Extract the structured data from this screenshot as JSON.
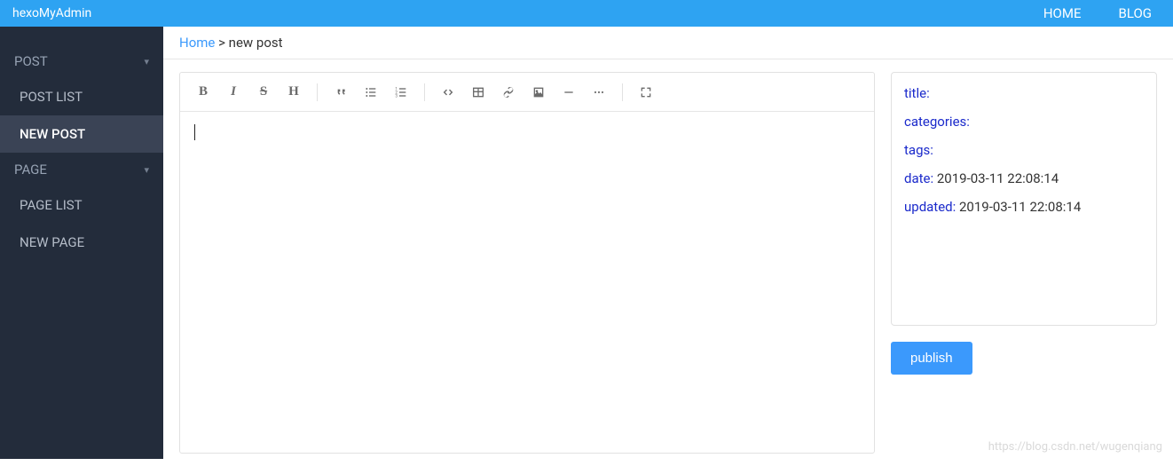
{
  "app": {
    "brand": "hexoMyAdmin"
  },
  "topnav": {
    "home": "HOME",
    "blog": "BLOG"
  },
  "sidebar": {
    "post_group": "POST",
    "post_list": "POST LIST",
    "new_post": "NEW POST",
    "page_group": "PAGE",
    "page_list": "PAGE LIST",
    "new_page": "NEW PAGE"
  },
  "breadcrumb": {
    "home": "Home",
    "sep": " > ",
    "current": "new post"
  },
  "toolbar": {
    "bold": "B",
    "italic": "I",
    "strike": "S",
    "heading": "H"
  },
  "meta": {
    "title_label": "title:",
    "categories_label": "categories:",
    "tags_label": "tags:",
    "date_label": "date:",
    "date_value": " 2019-03-11 22:08:14",
    "updated_label": "updated:",
    "updated_value": " 2019-03-11 22:08:14"
  },
  "actions": {
    "publish": "publish"
  },
  "watermark": "https://blog.csdn.net/wugenqiang"
}
